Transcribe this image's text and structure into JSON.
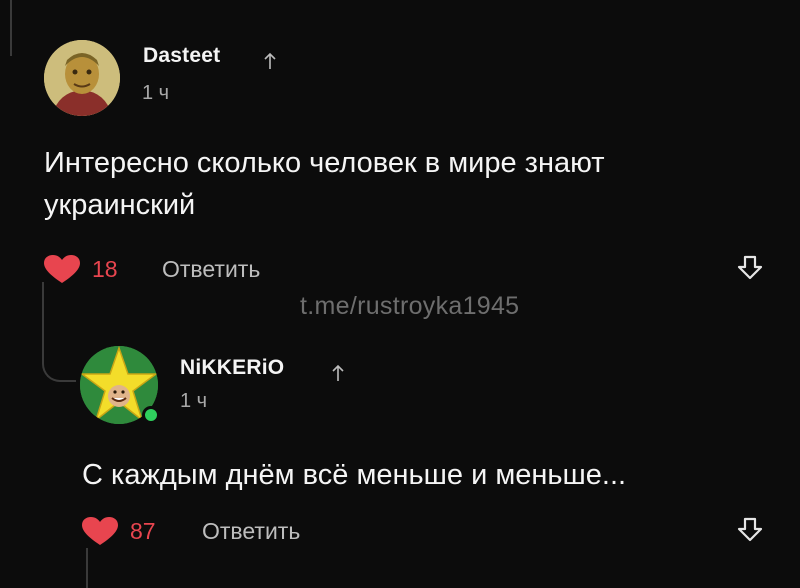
{
  "comment": {
    "username": "Dasteet",
    "time": "1 ч",
    "text_line1": "Интересно сколько человек в мире знают",
    "text_line2": "украинский",
    "likes": "18",
    "reply_label": "Ответить",
    "avatar_icon": "avatar-character-icon",
    "colors": {
      "heart": "#e8454f",
      "avatar_bg": "#c9b978"
    }
  },
  "watermark": "t.me/rustroyka1945",
  "reply": {
    "username": "NiKKERiO",
    "time": "1 ч",
    "text": "С каждым днём всё меньше и меньше...",
    "likes": "87",
    "reply_label": "Ответить",
    "avatar_icon": "avatar-star-icon",
    "colors": {
      "avatar_bg": "#2f8a3c",
      "star": "#f3dd2a",
      "online": "#2fcf5d"
    }
  }
}
